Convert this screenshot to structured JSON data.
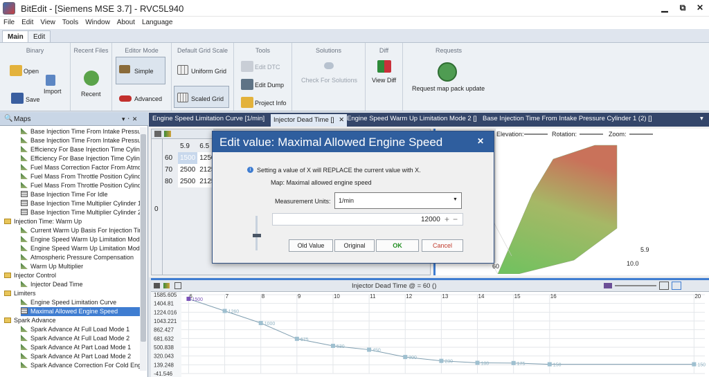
{
  "window": {
    "title": "BitEdit - [Siemens MSE 3.7] - RVC5L940",
    "min": "▁",
    "restore": "⧉",
    "close": "✕"
  },
  "menu": [
    "File",
    "Edit",
    "View",
    "Tools",
    "Window",
    "About",
    "Language"
  ],
  "ribbon_tabs": [
    "Main",
    "Edit"
  ],
  "ribbon": {
    "binary": {
      "label": "Binary",
      "open": "Open",
      "save": "Save",
      "import": "Import"
    },
    "recent": {
      "label": "Recent Files",
      "recent": "Recent"
    },
    "editor_mode": {
      "label": "Editor Mode",
      "simple": "Simple",
      "advanced": "Advanced"
    },
    "grid_scale": {
      "label": "Default Grid Scale",
      "uniform": "Uniform Grid",
      "scaled": "Scaled Grid"
    },
    "tools": {
      "label": "Tools",
      "edit_dtc": "Edit DTC",
      "edit_dump": "Edit Dump",
      "project_info": "Project Info"
    },
    "solutions": {
      "label": "Solutions",
      "check": "Check For Solutions"
    },
    "diff": {
      "label": "Diff",
      "view": "View Diff"
    },
    "requests": {
      "label": "Requests",
      "request": "Request map pack update"
    }
  },
  "left_panel": {
    "title": "Maps",
    "pin": "▾ ᛫ ✕"
  },
  "tree": [
    {
      "t": "Base Injection Time From Intake Pressur",
      "i": "leaf",
      "d": 2
    },
    {
      "t": "Base Injection Time From Intake Pressur",
      "i": "leaf",
      "d": 2
    },
    {
      "t": "Efficiency For Base Injection Time Cylinc",
      "i": "leaf",
      "d": 2
    },
    {
      "t": "Efficiency For Base Injection Time Cylinc",
      "i": "leaf",
      "d": 2
    },
    {
      "t": "Fuel Mass Correction Factor From Atmo",
      "i": "leaf",
      "d": 2
    },
    {
      "t": "Fuel Mass From Throttle Position Cylind",
      "i": "leaf",
      "d": 2
    },
    {
      "t": "Fuel Mass From Throttle Position Cylind",
      "i": "leaf",
      "d": 2
    },
    {
      "t": "Base Injection Time For Idle",
      "i": "tbl",
      "d": 2
    },
    {
      "t": "Base Injection Time Multiplier Cylinder 1",
      "i": "tbl",
      "d": 2
    },
    {
      "t": "Base Injection Time Multiplier Cylinder 2",
      "i": "tbl",
      "d": 2
    },
    {
      "t": "Injection Time: Warm Up",
      "i": "fold",
      "d": 1
    },
    {
      "t": "Current Warm Up Basis For Injection Tin",
      "i": "leaf",
      "d": 2
    },
    {
      "t": "Engine Speed Warm Up Limitation Mod",
      "i": "leaf",
      "d": 2
    },
    {
      "t": "Engine Speed Warm Up Limitation Mod",
      "i": "leaf",
      "d": 2
    },
    {
      "t": "Atmospheric Pressure Compensation",
      "i": "leaf",
      "d": 2
    },
    {
      "t": "Warm Up Multiplier",
      "i": "leaf",
      "d": 2
    },
    {
      "t": "Injector Control",
      "i": "fold",
      "d": 1
    },
    {
      "t": "Injector Dead Time",
      "i": "leaf",
      "d": 2
    },
    {
      "t": "Limiters",
      "i": "fold",
      "d": 1
    },
    {
      "t": "Engine Speed Limitation Curve",
      "i": "leaf",
      "d": 2
    },
    {
      "t": "Maximal Allowed Engine Speed",
      "i": "tbl",
      "d": 2,
      "sel": true
    },
    {
      "t": "Spark Advance",
      "i": "fold",
      "d": 1
    },
    {
      "t": "Spark Advance At Full Load Mode 1",
      "i": "leaf",
      "d": 2
    },
    {
      "t": "Spark Advance At Full Load Mode 2",
      "i": "leaf",
      "d": 2
    },
    {
      "t": "Spark Advance At Part Load Mode 1",
      "i": "leaf",
      "d": 2
    },
    {
      "t": "Spark Advance At Part Load Mode 2",
      "i": "leaf",
      "d": 2
    },
    {
      "t": "Spark Advance Correction For Cold Eng",
      "i": "leaf",
      "d": 2
    }
  ],
  "doc_tabs": [
    {
      "label": "Engine Speed Limitation Curve [1/min]",
      "active": false
    },
    {
      "label": "Injector Dead Time []",
      "active": true,
      "close": "✕"
    },
    {
      "label": "Engine Speed Warm Up Limitation Mode 2 []",
      "active": false
    },
    {
      "label": "Base Injection Time From Intake Pressure Cylinder 1 (2) []",
      "active": false
    }
  ],
  "grid": {
    "cols": [
      "5.9",
      "6.5"
    ],
    "rows": [
      {
        "h": "60",
        "c": [
          "1500",
          "1250"
        ]
      },
      {
        "h": "70",
        "c": [
          "2500",
          "2125"
        ]
      },
      {
        "h": "80",
        "c": [
          "2500",
          "2125"
        ]
      }
    ],
    "side": "0"
  },
  "plot3d": {
    "elevation": "Elevation:",
    "rotation": "Rotation:",
    "zoom": "Zoom:",
    "ticks": [
      "5.9",
      "10.0",
      "60"
    ]
  },
  "bottom_chart": {
    "title": "Injector Dead Time @  = 60 ()"
  },
  "chart_data": {
    "type": "line",
    "x": [
      6,
      7,
      8,
      9,
      10,
      11,
      12,
      13,
      14,
      15,
      16,
      20
    ],
    "values": [
      1500,
      1250,
      1000,
      675,
      530,
      450,
      300,
      220,
      180,
      175,
      150,
      150
    ],
    "labels": [
      "1500",
      "1250",
      "1000",
      "675",
      "530",
      "450",
      "300",
      "220",
      "180",
      "175",
      "150",
      "150"
    ],
    "point_labels": [
      "1500",
      "1260",
      "1000",
      "675",
      "530",
      "450",
      "300",
      "230",
      "180",
      "175",
      "150",
      "150"
    ],
    "x_ticks": [
      "6",
      "7",
      "8",
      "9",
      "10",
      "11",
      "12",
      "13",
      "14",
      "15",
      "16",
      "20"
    ],
    "y_ticks": [
      "1585.605",
      "1404.81",
      "1224.016",
      "1043.221",
      "862.427",
      "681.632",
      "500.838",
      "320.043",
      "139.248",
      "-41.546"
    ],
    "ylim": [
      -41.546,
      1585.605
    ]
  },
  "dialog": {
    "title": "Edit value: Maximal Allowed Engine Speed",
    "close": "✕",
    "info": "Setting a value of X will REPLACE the current value with X.",
    "map": "Map: Maximal allowed engine speed",
    "units_label": "Measurement Units:",
    "units_value": "1/min",
    "value": "12000",
    "old": "Old Value",
    "original": "Original",
    "ok": "OK",
    "cancel": "Cancel"
  },
  "colors": {
    "accent": "#3f7dd1",
    "dialog_head": "#2f5e9e",
    "tabbar": "#34466a",
    "ok_green": "#1e8c1e",
    "cancel_red": "#c0392b"
  }
}
